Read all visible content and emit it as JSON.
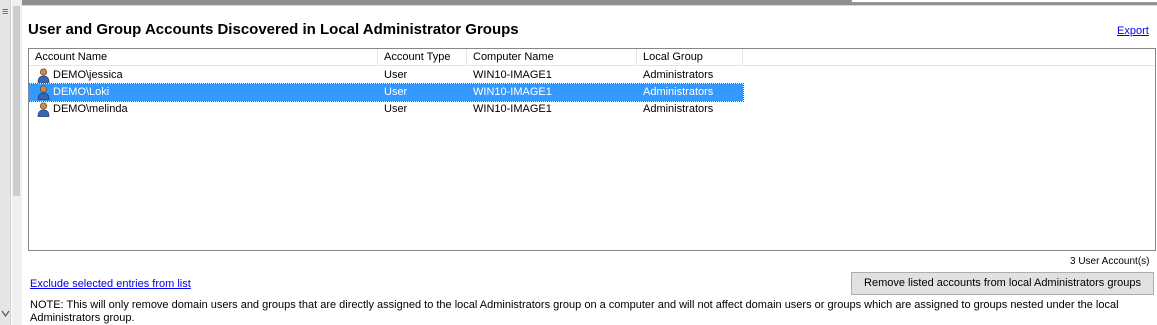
{
  "left_strip": {
    "menu_glyph": "≡",
    "scroll_glyph": "chevron-down"
  },
  "title": "User and Group Accounts Discovered in Local Administrator Groups",
  "export_label": "Export",
  "list": {
    "columns": [
      "Account Name",
      "Account Type",
      "Computer Name",
      "Local Group"
    ],
    "rows": [
      {
        "account": "DEMO\\jessica",
        "type": "User",
        "computer": "WIN10-IMAGE1",
        "group": "Administrators",
        "selected": false,
        "icon": "user-icon"
      },
      {
        "account": "DEMO\\Loki",
        "type": "User",
        "computer": "WIN10-IMAGE1",
        "group": "Administrators",
        "selected": true,
        "icon": "user-icon"
      },
      {
        "account": "DEMO\\melinda",
        "type": "User",
        "computer": "WIN10-IMAGE1",
        "group": "Administrators",
        "selected": false,
        "icon": "user-icon"
      }
    ]
  },
  "count_label": "3 User Account(s)",
  "exclude_label": "Exclude selected entries from list",
  "remove_button_label": "Remove listed accounts from local Administrators groups",
  "note": "NOTE:  This will only remove domain users and groups that are directly assigned to the local Administrators group on a computer and will not affect domain users or groups which are assigned to groups nested under the local Administrators group.",
  "colors": {
    "selection": "#3399ff",
    "link": "#0000ee"
  }
}
